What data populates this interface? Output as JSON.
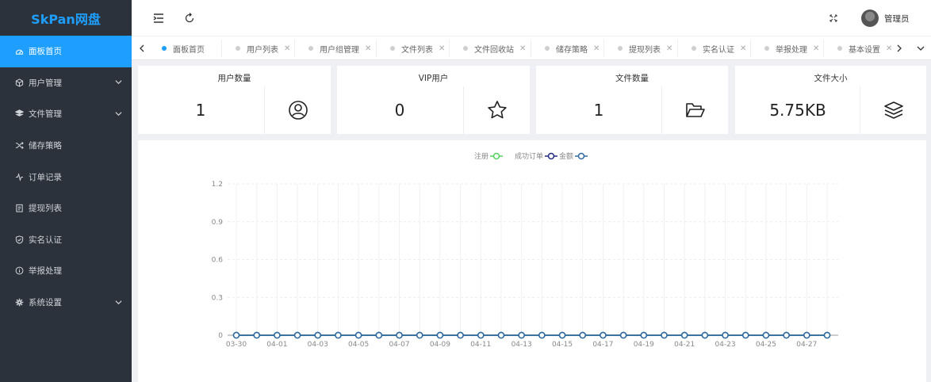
{
  "app": {
    "logo": "SkPan网盘"
  },
  "sidebar": {
    "items": [
      {
        "label": "面板首页",
        "icon": "dashboard-icon",
        "active": true,
        "expandable": false
      },
      {
        "label": "用户管理",
        "icon": "cube-icon",
        "active": false,
        "expandable": true
      },
      {
        "label": "文件管理",
        "icon": "layers-icon",
        "active": false,
        "expandable": true
      },
      {
        "label": "储存策略",
        "icon": "shuffle-icon",
        "active": false,
        "expandable": false
      },
      {
        "label": "订单记录",
        "icon": "activity-icon",
        "active": false,
        "expandable": false
      },
      {
        "label": "提现列表",
        "icon": "clipboard-icon",
        "active": false,
        "expandable": false
      },
      {
        "label": "实名认证",
        "icon": "shield-icon",
        "active": false,
        "expandable": false
      },
      {
        "label": "举报处理",
        "icon": "info-icon",
        "active": false,
        "expandable": false
      },
      {
        "label": "系统设置",
        "icon": "gear-icon",
        "active": false,
        "expandable": true
      }
    ]
  },
  "header": {
    "menu_toggle_icon": "menu-fold-icon",
    "refresh_icon": "refresh-icon",
    "fullscreen_icon": "fullscreen-icon",
    "user_name": "管理员"
  },
  "tabs": [
    {
      "label": "面板首页",
      "active": true,
      "closable": false
    },
    {
      "label": "用户列表",
      "active": false,
      "closable": true
    },
    {
      "label": "用户组管理",
      "active": false,
      "closable": true
    },
    {
      "label": "文件列表",
      "active": false,
      "closable": true
    },
    {
      "label": "文件回收站",
      "active": false,
      "closable": true
    },
    {
      "label": "储存策略",
      "active": false,
      "closable": true
    },
    {
      "label": "提现列表",
      "active": false,
      "closable": true
    },
    {
      "label": "实名认证",
      "active": false,
      "closable": true
    },
    {
      "label": "举报处理",
      "active": false,
      "closable": true
    },
    {
      "label": "基本设置",
      "active": false,
      "closable": true
    }
  ],
  "stats": [
    {
      "title": "用户数量",
      "value": "1",
      "icon": "user-circle-icon"
    },
    {
      "title": "VIP用户",
      "value": "0",
      "icon": "star-icon"
    },
    {
      "title": "文件数量",
      "value": "1",
      "icon": "folder-open-icon"
    },
    {
      "title": "文件大小",
      "value": "5.75KB",
      "icon": "stack-icon"
    }
  ],
  "chart_data": {
    "type": "line",
    "title": "",
    "xlabel": "",
    "ylabel": "",
    "ylim": [
      0,
      1.2
    ],
    "yticks": [
      0,
      0.3,
      0.6,
      0.9,
      1.2
    ],
    "legend_position": "top-center",
    "grid": true,
    "x": [
      "03-30",
      "03-31",
      "04-01",
      "04-02",
      "04-03",
      "04-04",
      "04-05",
      "04-06",
      "04-07",
      "04-08",
      "04-09",
      "04-10",
      "04-11",
      "04-12",
      "04-13",
      "04-14",
      "04-15",
      "04-16",
      "04-17",
      "04-18",
      "04-19",
      "04-20",
      "04-21",
      "04-22",
      "04-23",
      "04-24",
      "04-25",
      "04-26",
      "04-27",
      "04-28"
    ],
    "x_tick_labels": [
      "03-30",
      "04-01",
      "04-03",
      "04-05",
      "04-07",
      "04-09",
      "04-11",
      "04-13",
      "04-15",
      "04-17",
      "04-19",
      "04-21",
      "04-23",
      "04-25",
      "04-27"
    ],
    "series": [
      {
        "name": "注册",
        "color": "#52d35f",
        "values": [
          0,
          0,
          0,
          0,
          0,
          0,
          0,
          0,
          0,
          0,
          0,
          0,
          0,
          0,
          0,
          0,
          0,
          0,
          0,
          0,
          0,
          0,
          0,
          0,
          0,
          0,
          0,
          0,
          0,
          0
        ]
      },
      {
        "name": "成功订单",
        "color": "#1f2a80",
        "values": [
          0,
          0,
          0,
          0,
          0,
          0,
          0,
          0,
          0,
          0,
          0,
          0,
          0,
          0,
          0,
          0,
          0,
          0,
          0,
          0,
          0,
          0,
          0,
          0,
          0,
          0,
          0,
          0,
          0,
          0
        ]
      },
      {
        "name": "金额",
        "color": "#2d6aa3",
        "values": [
          0,
          0,
          0,
          0,
          0,
          0,
          0,
          0,
          0,
          0,
          0,
          0,
          0,
          0,
          0,
          0,
          0,
          0,
          0,
          0,
          0,
          0,
          0,
          0,
          0,
          0,
          0,
          0,
          0,
          0
        ]
      }
    ]
  }
}
